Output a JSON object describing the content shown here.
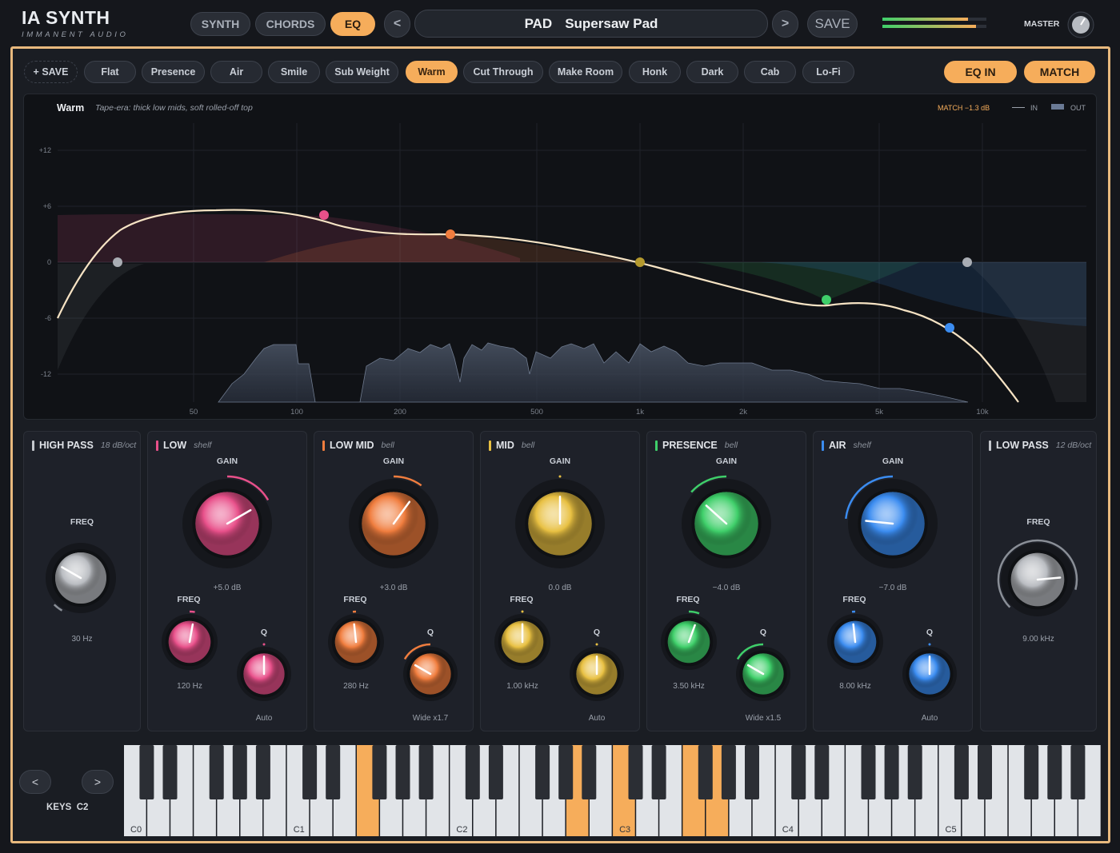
{
  "brand": {
    "title": "IA SYNTH",
    "subtitle": "IMMANENT AUDIO"
  },
  "top_tabs": [
    {
      "label": "SYNTH",
      "active": false
    },
    {
      "label": "CHORDS",
      "active": false
    },
    {
      "label": "EQ",
      "active": true
    }
  ],
  "patch": {
    "prev": "<",
    "next": ">",
    "category": "PAD",
    "name": "Supersaw Pad",
    "save": "SAVE"
  },
  "master": {
    "label": "MASTER",
    "meter_levels": [
      0.82,
      0.9
    ]
  },
  "presets": {
    "save_label": "+ SAVE",
    "items": [
      "Flat",
      "Presence",
      "Air",
      "Smile",
      "Sub Weight",
      "Warm",
      "Cut Through",
      "Make Room",
      "Honk",
      "Dark",
      "Cab",
      "Lo-Fi"
    ],
    "active": "Warm"
  },
  "eq_in": "EQ IN",
  "match": "MATCH",
  "graph": {
    "preset_name": "Warm",
    "preset_desc": "Tape-era: thick low mids, soft rolled-off top",
    "match_readout": "MATCH −1.3 dB",
    "legend_in": "IN",
    "legend_out": "OUT",
    "y_ticks": [
      "+12",
      "+6",
      "0",
      "-6",
      "-12"
    ],
    "x_ticks": [
      "50",
      "100",
      "200",
      "500",
      "1k",
      "2k",
      "5k",
      "10k"
    ]
  },
  "bands": {
    "highpass": {
      "name": "HIGH PASS",
      "type": "18 dB/oct",
      "freq_label": "FREQ",
      "freq": "30 Hz",
      "color": "#c4c7cc"
    },
    "low": {
      "name": "LOW",
      "type": "shelf",
      "gain_label": "GAIN",
      "gain": "+5.0 dB",
      "freq_label": "FREQ",
      "freq": "120 Hz",
      "q_label": "Q",
      "q": "Auto",
      "color": "#e8508a"
    },
    "lowmid": {
      "name": "LOW MID",
      "type": "bell",
      "gain_label": "GAIN",
      "gain": "+3.0 dB",
      "freq_label": "FREQ",
      "freq": "280 Hz",
      "q_label": "Q",
      "q": "Wide x1.7",
      "color": "#f07d3e"
    },
    "mid": {
      "name": "MID",
      "type": "bell",
      "gain_label": "GAIN",
      "gain": "0.0 dB",
      "freq_label": "FREQ",
      "freq": "1.00 kHz",
      "q_label": "Q",
      "q": "Auto",
      "color": "#e8c042"
    },
    "presence": {
      "name": "PRESENCE",
      "type": "bell",
      "gain_label": "GAIN",
      "gain": "−4.0 dB",
      "freq_label": "FREQ",
      "freq": "3.50 kHz",
      "q_label": "Q",
      "q": "Wide x1.5",
      "color": "#3fcf6a"
    },
    "air": {
      "name": "AIR",
      "type": "shelf",
      "gain_label": "GAIN",
      "gain": "−7.0 dB",
      "freq_label": "FREQ",
      "freq": "8.00 kHz",
      "q_label": "Q",
      "q": "Auto",
      "color": "#3b8cf0"
    },
    "lowpass": {
      "name": "LOW PASS",
      "type": "12 dB/oct",
      "freq_label": "FREQ",
      "freq": "9.00 kHz",
      "color": "#c4c7cc"
    }
  },
  "keyboard": {
    "prev": "<",
    "next": ">",
    "label": "KEYS",
    "octave": "C2",
    "octave_labels": [
      "C0",
      "C1",
      "C2",
      "C3",
      "C4",
      "C5"
    ]
  }
}
